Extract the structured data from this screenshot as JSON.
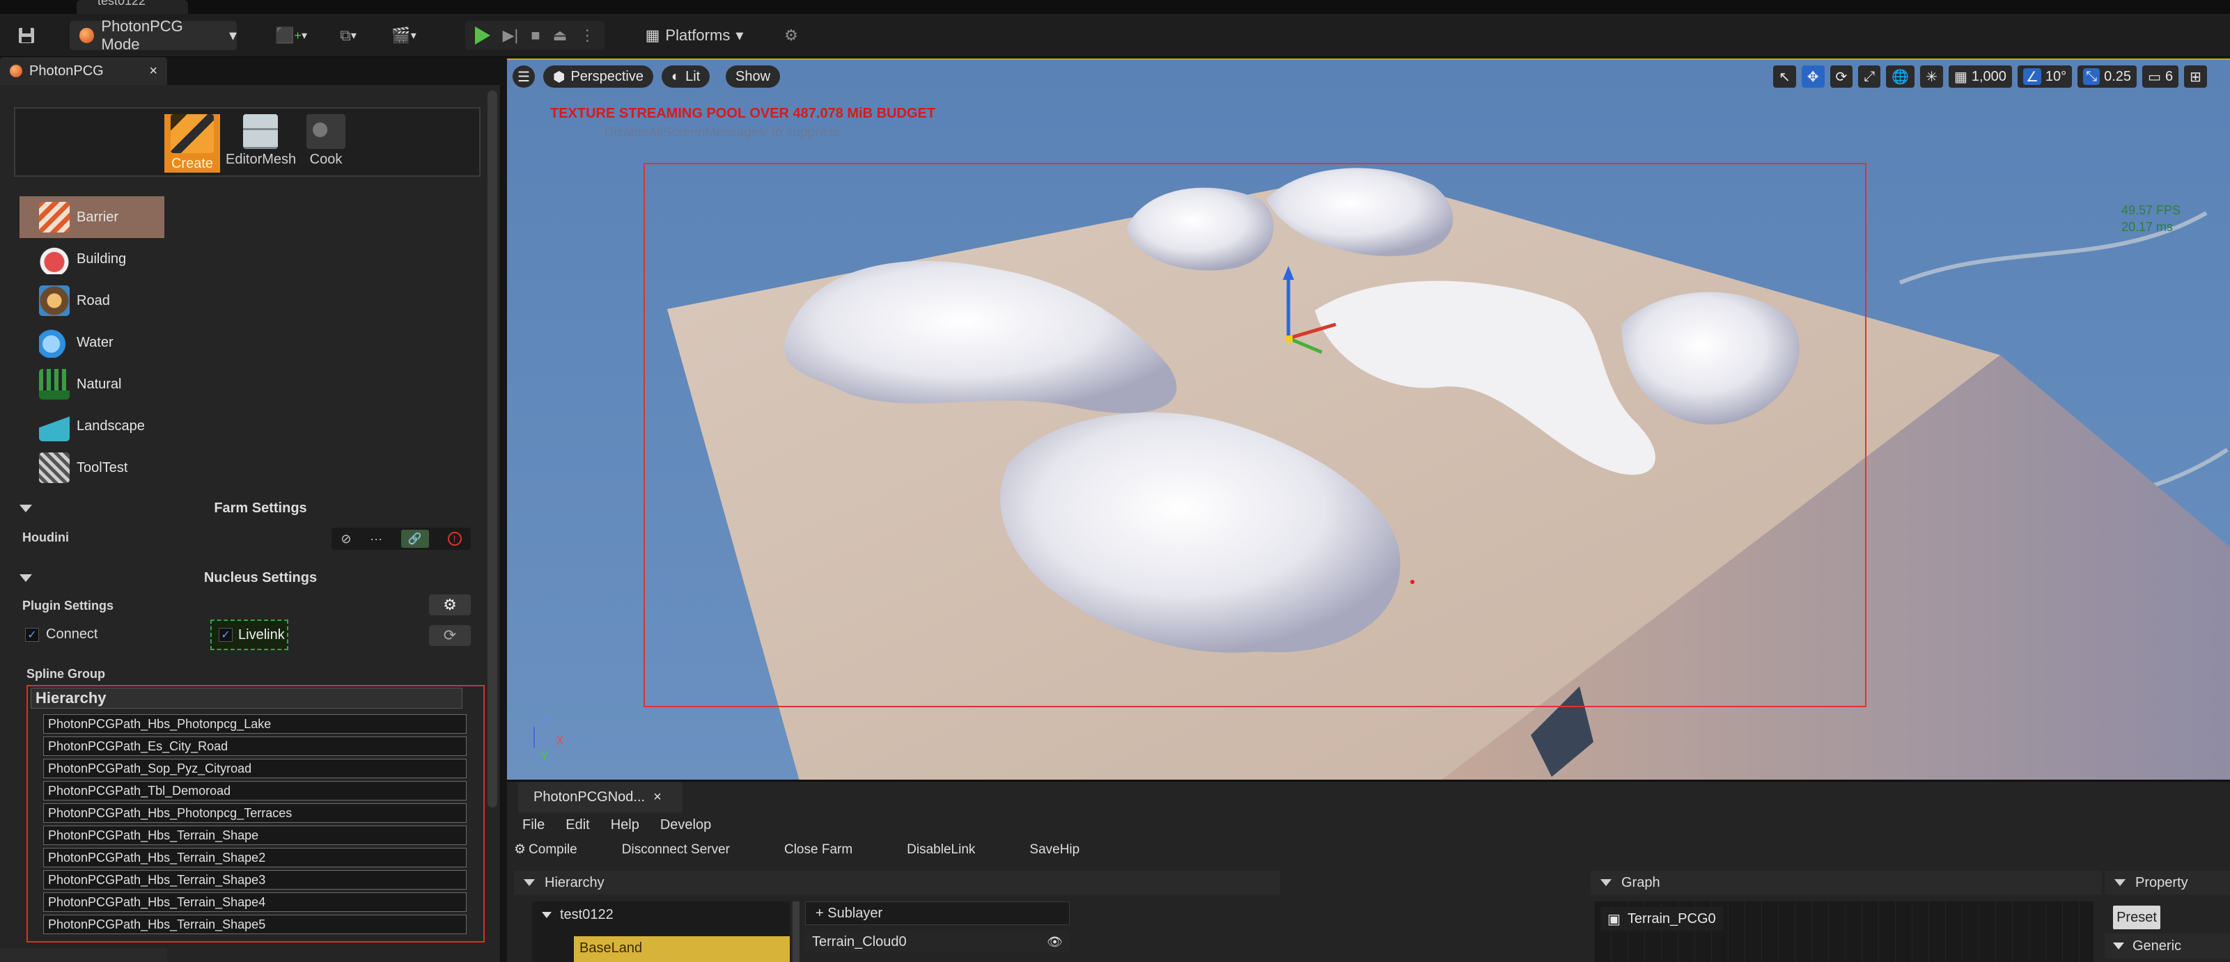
{
  "window": {
    "tab_title": "test0122"
  },
  "toolbar": {
    "mode_label": "PhotonPCG Mode",
    "platforms_label": "Platforms"
  },
  "left_panel": {
    "tab_label": "PhotonPCG",
    "create_tabs": [
      "Create",
      "EditorMesh",
      "Cook"
    ],
    "categories": [
      {
        "label": "Barrier",
        "icon": "barrier-icon"
      },
      {
        "label": "Building",
        "icon": "building-icon"
      },
      {
        "label": "Road",
        "icon": "road-icon"
      },
      {
        "label": "Water",
        "icon": "water-icon"
      },
      {
        "label": "Natural",
        "icon": "trees-icon"
      },
      {
        "label": "Landscape",
        "icon": "landscape-icon"
      },
      {
        "label": "ToolTest",
        "icon": "tools-icon"
      }
    ],
    "farm_settings": {
      "title": "Farm Settings",
      "houdini_label": "Houdini"
    },
    "nucleus_settings": {
      "title": "Nucleus Settings",
      "plugin_settings_label": "Plugin Settings",
      "connect_label": "Connect",
      "livelink_label": "Livelink"
    },
    "spline_group": {
      "label": "Spline Group",
      "header": "Hierarchy",
      "items": [
        "PhotonPCGPath_Hbs_Photonpcg_Lake",
        "PhotonPCGPath_Es_City_Road",
        "PhotonPCGPath_Sop_Pyz_Cityroad",
        "PhotonPCGPath_Tbl_Demoroad",
        "PhotonPCGPath_Hbs_Photonpcg_Terraces",
        "PhotonPCGPath_Hbs_Terrain_Shape",
        "PhotonPCGPath_Hbs_Terrain_Shape2",
        "PhotonPCGPath_Hbs_Terrain_Shape3",
        "PhotonPCGPath_Hbs_Terrain_Shape4",
        "PhotonPCGPath_Hbs_Terrain_Shape5"
      ]
    }
  },
  "viewport": {
    "perspective_label": "Perspective",
    "lit_label": "Lit",
    "show_label": "Show",
    "grid_snap": "1,000",
    "rotation_snap": "10°",
    "scale_snap": "0.25",
    "camera_speed": "6",
    "warning": "TEXTURE STREAMING POOL OVER 487.078 MiB BUDGET",
    "warning_hint": "'DisableAllScreenMessages' to suppress",
    "fps": "49.57 FPS",
    "frame_ms": "20.17 ms",
    "axes": {
      "z": "Z",
      "x": "X",
      "y": "Y"
    }
  },
  "graph_panel": {
    "tab_label": "PhotonPCGNod...",
    "menu": [
      "File",
      "Edit",
      "Help",
      "Develop"
    ],
    "actions": [
      "Compile",
      "Disconnect Server",
      "Close Farm",
      "DisableLink",
      "SaveHip"
    ],
    "hierarchy_title": "Hierarchy",
    "graph_title": "Graph",
    "property_title": "Property",
    "tree_root": "test0122",
    "tree_selected": "BaseLand",
    "sublayer_label": "+ Sublayer",
    "layer_item": "Terrain_Cloud0",
    "graph_node": "Terrain_PCG0",
    "preset_label": "Preset",
    "generic_label": "Generic"
  }
}
